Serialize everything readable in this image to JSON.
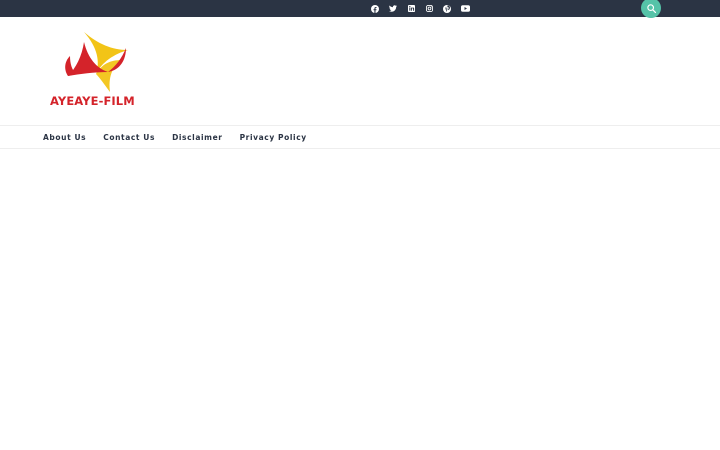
{
  "header": {
    "social_icons": [
      {
        "name": "facebook-icon"
      },
      {
        "name": "twitter-icon"
      },
      {
        "name": "linkedin-icon"
      },
      {
        "name": "instagram-icon"
      },
      {
        "name": "pinterest-icon"
      },
      {
        "name": "youtube-icon"
      }
    ],
    "search_icon": "search-icon"
  },
  "branding": {
    "site_name": "AYEAYE-FILM"
  },
  "nav": {
    "items": [
      {
        "label": "About Us"
      },
      {
        "label": "Contact Us"
      },
      {
        "label": "Disclaimer"
      },
      {
        "label": "Privacy Policy"
      }
    ]
  },
  "colors": {
    "topbar": "#2b3444",
    "accent": "#55c3a8",
    "brand_red": "#d4232a",
    "brand_yellow": "#f2c417"
  }
}
